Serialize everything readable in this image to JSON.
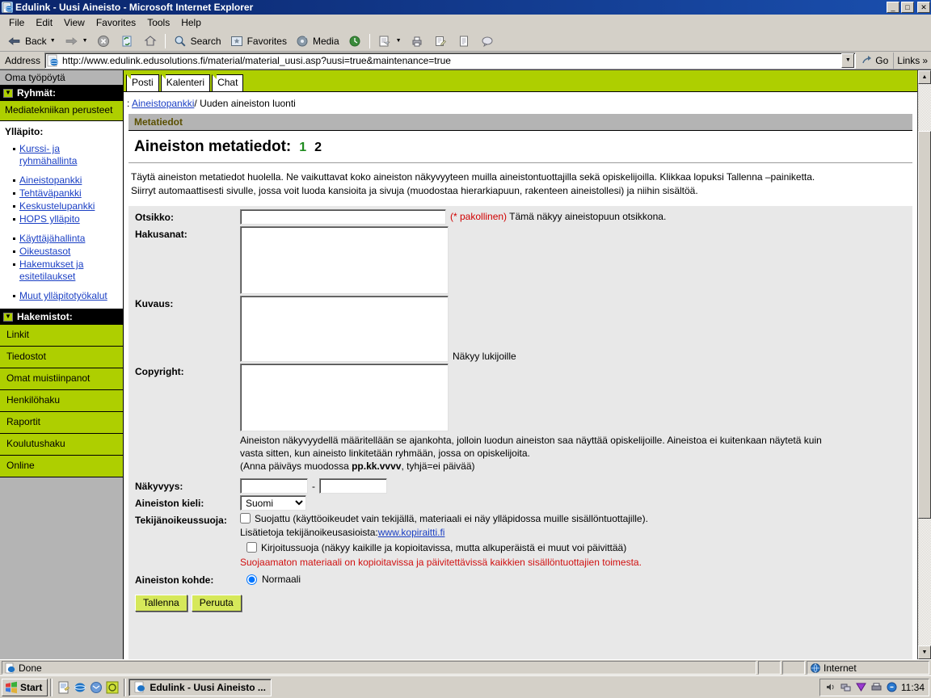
{
  "window": {
    "title": "Edulink - Uusi Aineisto - Microsoft Internet Explorer",
    "icon": "ie-document-icon",
    "minimize": "_",
    "maximize": "□",
    "close": "✕"
  },
  "menu": {
    "items": [
      "File",
      "Edit",
      "View",
      "Favorites",
      "Tools",
      "Help"
    ]
  },
  "toolbar": {
    "back": "Back",
    "forward": "",
    "stop": "",
    "refresh": "",
    "home": "",
    "search": "Search",
    "favorites": "Favorites",
    "media": "Media",
    "history": "",
    "mail": "",
    "print": "",
    "edit": "",
    "discuss": ""
  },
  "address": {
    "label": "Address",
    "url": "http://www.edulink.edusolutions.fi/material/material_uusi.asp?uusi=true&maintenance=true",
    "go": "Go",
    "links": "Links",
    "links_chevron": "»"
  },
  "sidebar": {
    "header": "Oma työpöytä",
    "groups_header": "Ryhmät:",
    "group_item": "Mediatekniikan perusteet",
    "admin_header": "Ylläpito:",
    "admin_links": [
      "Kurssi- ja ryhmähallinta",
      "Aineistopankki",
      "Tehtäväpankki",
      "Keskustelupankki",
      "HOPS ylläpito",
      "Käyttäjähallinta",
      "Oikeustasot",
      "Hakemukset ja esitetilaukset",
      "Muut ylläpitotyökalut"
    ],
    "directories_header": "Hakemistot:",
    "directories": [
      "Linkit",
      "Tiedostot",
      "Omat muistiinpanot",
      "Henkilöhaku",
      "Raportit",
      "Koulutushaku",
      "Online"
    ]
  },
  "tabs": [
    "Posti",
    "Kalenteri",
    "Chat"
  ],
  "breadcrumb": {
    "prefix": ":",
    "link": "Aineistopankki",
    "separator": "/",
    "current": "Uuden aineiston luonti"
  },
  "page": {
    "section_header": "Metatiedot",
    "title": "Aineiston metatiedot:",
    "step_current": "1",
    "step_next": "2",
    "intro_line1": "Täytä aineiston metatiedot huolella. Ne vaikuttavat koko aineiston näkyvyyteen muilla aineistontuottajilla sekä opiskelijoilla. Klikkaa lopuksi Tallenna –painiketta.",
    "intro_line2": "Siirryt automaattisesti sivulle, jossa voit luoda kansioita ja sivuja (muodostaa hierarkiapuun, rakenteen aineistollesi) ja niihin sisältöä."
  },
  "form": {
    "otsikko_label": "Otsikko:",
    "otsikko_value": "",
    "otsikko_required": "(* pakollinen)",
    "otsikko_hint": "Tämä näkyy aineistopuun otsikkona.",
    "hakusanat_label": "Hakusanat:",
    "hakusanat_value": "",
    "kuvaus_label": "Kuvaus:",
    "kuvaus_value": "",
    "kuvaus_hint": "Näkyy lukijoille",
    "copyright_label": "Copyright:",
    "copyright_value": "",
    "visibility_note_1": "Aineiston näkyvyydellä määritellään se ajankohta, jolloin luodun aineiston saa näyttää opiskelijoille. Aineistoa ei kuitenkaan näytetä kuin",
    "visibility_note_2": "vasta sitten, kun aineisto linkitetään ryhmään, jossa on opiskelijoita.",
    "visibility_note_3_pre": "(Anna päiväys muodossa ",
    "visibility_note_3_bold": "pp.kk.vvvv",
    "visibility_note_3_post": ", tyhjä=ei päivää)",
    "nakyvyys_label": "Näkyvyys:",
    "nakyvyys_from": "",
    "nakyvyys_dash": "-",
    "nakyvyys_to": "",
    "kieli_label": "Aineiston kieli:",
    "kieli_value": "Suomi",
    "kieli_options": [
      "Suomi"
    ],
    "tekija_label": "Tekijänoikeussuoja:",
    "suojattu_checked": false,
    "suojattu_text": "Suojattu (käyttöoikeudet vain tekijällä, materiaali ei näy ylläpidossa muille sisällöntuottajille).",
    "lisatietoja_text": "Lisätietoja tekijänoikeusasioista:",
    "lisatietoja_link": "www.kopiraitti.fi",
    "kirjoitussuoja_checked": false,
    "kirjoitussuoja_text": "Kirjoitussuoja (näkyy kaikille ja kopioitavissa, mutta alkuperäistä ei muut voi päivittää)",
    "suojaamaton_warning": "Suojaamaton materiaali on kopioitavissa ja päivitettävissä kaikkien sisällöntuottajien toimesta.",
    "kohde_label": "Aineiston kohde:",
    "kohde_option": "Normaali",
    "kohde_checked": true,
    "save_button": "Tallenna",
    "cancel_button": "Peruuta"
  },
  "statusbar": {
    "text": "Done",
    "zone": "Internet",
    "zone_icon": "globe-icon"
  },
  "taskbar": {
    "start": "Start",
    "task": "Edulink - Uusi Aineisto ...",
    "clock": "11:34"
  },
  "colors": {
    "brand_green": "#aecf00",
    "title_blue": "#0a246a",
    "link_blue": "#1a3fc4",
    "warn_red": "#d01010",
    "button_green": "#d6e85a"
  }
}
